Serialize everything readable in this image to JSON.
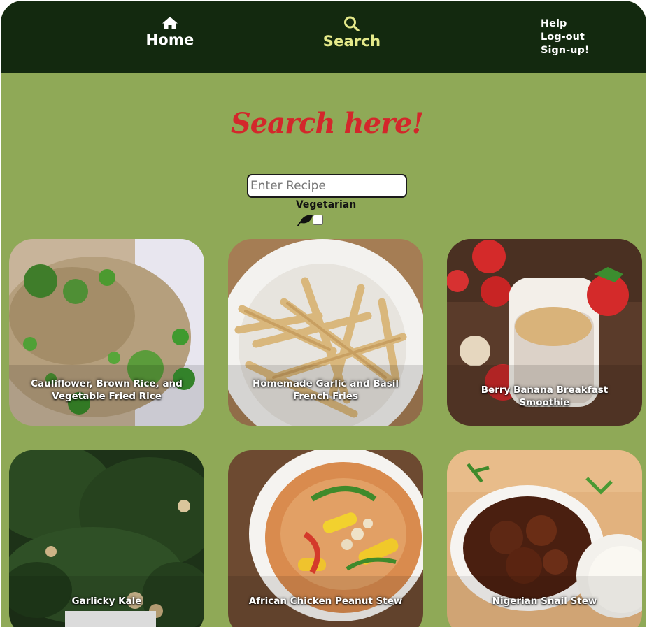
{
  "nav": {
    "home_label": "Home",
    "home_icon": "home-icon",
    "search_label": "Search",
    "search_icon": "search-icon",
    "active_color": "#e4e98a",
    "account_links": [
      "Help",
      "Log-out",
      "Sign-up!"
    ]
  },
  "colors": {
    "header_bg": "#13290f",
    "page_bg": "#8fa957",
    "title_color": "#d3272b"
  },
  "search": {
    "title": "Search here!",
    "placeholder": "Enter Recipe",
    "value": "",
    "vegetarian_label": "Vegetarian",
    "vegetarian_icon": "leaf-icon",
    "vegetarian_checked": false
  },
  "recipes": [
    {
      "title": "Cauliflower, Brown Rice, and Vegetable Fried Rice"
    },
    {
      "title": "Homemade Garlic and Basil French Fries"
    },
    {
      "title": "Berry Banana Breakfast Smoothie"
    },
    {
      "title": "Garlicky Kale"
    },
    {
      "title": "African Chicken Peanut Stew"
    },
    {
      "title": "Nigerian Snail Stew"
    }
  ]
}
